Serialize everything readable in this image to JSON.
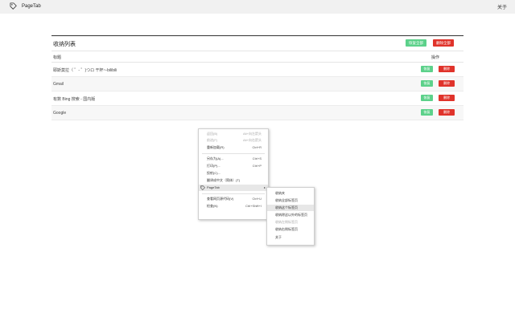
{
  "navbar": {
    "brand_title": "PageTab",
    "about_label": "关于"
  },
  "card": {
    "title": "收纳列表",
    "restore_all_label": "恢复全部",
    "delete_all_label": "删除全部"
  },
  "table": {
    "col_title": "标题",
    "col_ops": "操作",
    "rows": [
      {
        "title": "耶斯莫拉（ ゜- ゜)つロ 干杯~-bilibili",
        "edit_label": "恢复",
        "delete_label": "删除"
      },
      {
        "title": "Gmail",
        "edit_label": "恢复",
        "delete_label": "删除"
      },
      {
        "title": "有数 Bing 搜索 - 国内版",
        "edit_label": "恢复",
        "delete_label": "删除"
      },
      {
        "title": "Google",
        "edit_label": "恢复",
        "delete_label": "删除"
      }
    ]
  },
  "context_menu": {
    "items": [
      {
        "label": "返回(B)",
        "shortcut": "Alt+向左箭头",
        "disabled": true
      },
      {
        "label": "前进(F)",
        "shortcut": "Alt+向右箭头",
        "disabled": true
      },
      {
        "label": "重新加载(R)",
        "shortcut": "Ctrl+R",
        "disabled": false
      },
      {
        "label": "另存为(A)...",
        "shortcut": "Ctrl+S",
        "disabled": false
      },
      {
        "label": "打印(P)...",
        "shortcut": "Ctrl+P",
        "disabled": false
      },
      {
        "label": "投射(C)...",
        "shortcut": "",
        "disabled": false
      },
      {
        "label": "翻译成中文（简体）(T)",
        "shortcut": "",
        "disabled": false
      },
      {
        "label": "PageTab",
        "shortcut": "",
        "disabled": false
      },
      {
        "label": "查看网页源代码(V)",
        "shortcut": "Ctrl+U",
        "disabled": false
      },
      {
        "label": "检查(N)",
        "shortcut": "Ctrl+Shift+I",
        "disabled": false
      }
    ]
  },
  "submenu": {
    "items": [
      {
        "label": "收纳夹",
        "disabled": false
      },
      {
        "label": "收纳全部标签页",
        "disabled": false
      },
      {
        "label": "收纳这个标签页",
        "disabled": false
      },
      {
        "label": "收纳除这以外的标签页",
        "disabled": false
      },
      {
        "label": "收纳左侧标签页",
        "disabled": true
      },
      {
        "label": "收纳右侧标签页",
        "disabled": false
      },
      {
        "label": "关于",
        "disabled": false
      }
    ]
  },
  "colors": {
    "navbar_bg": "#f1f1f1",
    "restore_green": "#5cd18a",
    "delete_red": "#e0332b"
  },
  "icons": {
    "brand": "tag-icon",
    "menu_item": "tag-icon",
    "submenu_arrow": "chevron-right-icon"
  }
}
